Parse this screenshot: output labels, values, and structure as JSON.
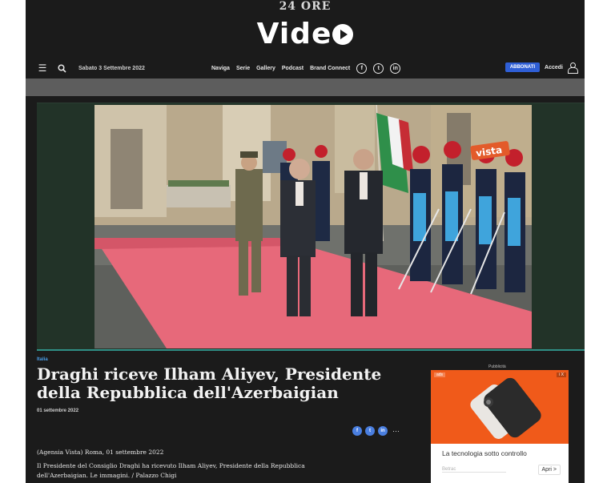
{
  "masthead": {
    "brand_small": "24 ORE",
    "brand_video": "Vide",
    "date": "Sabato 3 Settembre 2022"
  },
  "nav": {
    "links": [
      "Naviga",
      "Serie",
      "Gallery",
      "Podcast",
      "Brand Connect"
    ],
    "social": [
      "f",
      "t",
      "in"
    ],
    "subscribe_label": "ABBONATI",
    "login_label": "Accedi"
  },
  "player": {
    "watermark": "vista"
  },
  "article": {
    "kicker": "Italia",
    "headline": "Draghi riceve Ilham Aliyev, Presidente della Repubblica dell'Azerbaigian",
    "date": "01 settembre 2022",
    "share_buttons": [
      "f",
      "t",
      "in"
    ],
    "share_more": "···",
    "body_line1": "(Agensia Vista) Roma, 01 settembre 2022",
    "body_line2": "Il Presidente del Consiglio Draghi ha ricevuto Ilham Aliyev, Presidente della Repubblica",
    "body_line3": "dell'Azerbaigian. Le immagini. / Palazzo Chigi"
  },
  "ad": {
    "label": "Pubblicità",
    "logo": "ads",
    "close": "i X",
    "title": "La tecnologia sotto controllo",
    "input_placeholder": "Betrac",
    "button_label": "Apri >",
    "accent_color": "#f05a1a"
  },
  "colors": {
    "background": "#1b1b1b",
    "band": "#5d5d5d",
    "accent_blue": "#2f5fd6",
    "carpet": "#e7697a"
  }
}
